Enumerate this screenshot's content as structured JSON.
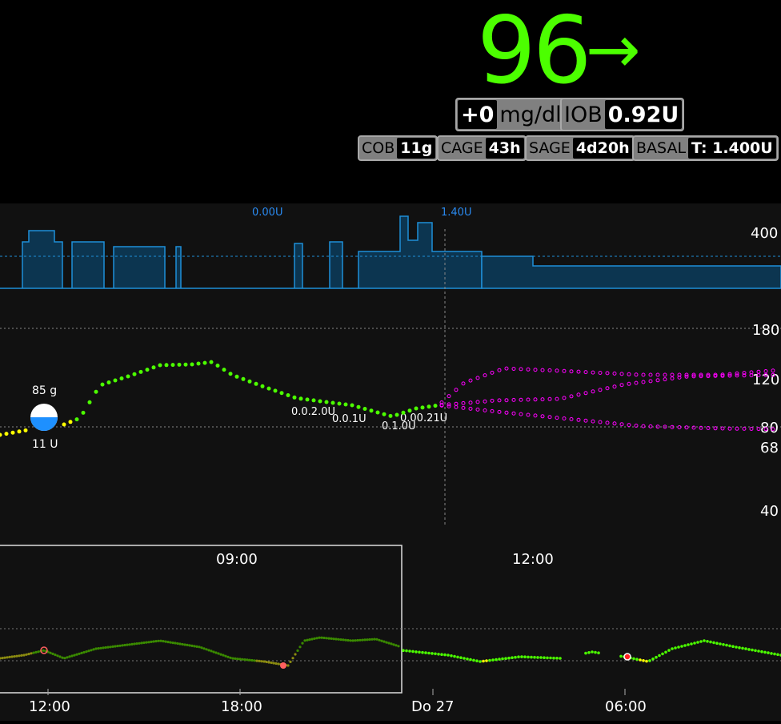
{
  "header": {
    "bg_value": "96",
    "trend_arrow": "→",
    "delta": "+0",
    "units": "mg/dl",
    "iob_label": "IOB",
    "iob_value": "0.92U",
    "pills": [
      {
        "label": "COB",
        "value": "11g"
      },
      {
        "label": "CAGE",
        "value": "43h"
      },
      {
        "label": "SAGE",
        "value": "4d20h"
      },
      {
        "label": "BASAL",
        "value": "T: 1.400U"
      }
    ]
  },
  "chart": {
    "basal_labels": [
      "0.00U",
      "1.40U"
    ],
    "basal_axis_label": "400",
    "y_axis_labels": [
      "180",
      "120",
      "80",
      "68",
      "40"
    ],
    "carb_label": "85 g",
    "insulin_label": "11 U",
    "bolus_labels": [
      "0.0.2.0U",
      "0.0.1U",
      "0.1.0U",
      "0.00.21U"
    ],
    "colors": {
      "in_range": "#4cff00",
      "low_warn": "#ffff00",
      "forecast": "#ff00ff",
      "basal": "#0099ff",
      "nav_range": "#3a8a00"
    }
  },
  "navigator": {
    "top_labels": [
      "09:00",
      "12:00"
    ],
    "bottom_labels": [
      "12:00",
      "18:00",
      "Do 27",
      "06:00"
    ]
  }
}
